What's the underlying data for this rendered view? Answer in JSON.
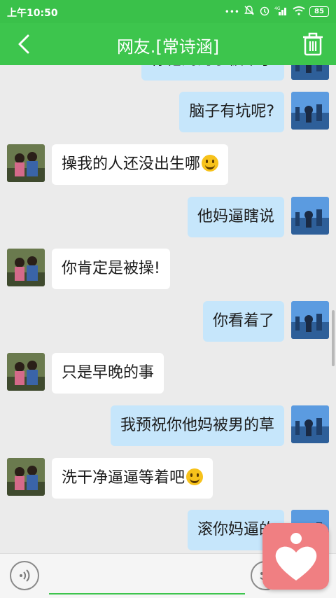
{
  "status_bar": {
    "time": "上午10:50",
    "battery": "85",
    "icons": [
      "more-dots-icon",
      "mute-bell-icon",
      "alarm-icon",
      "signal-4g-icon",
      "wifi-icon",
      "battery-icon"
    ]
  },
  "header": {
    "title": "网友.[常诗涵]",
    "back_icon": "chevron-left-icon",
    "trash_icon": "trash-icon"
  },
  "messages": [
    {
      "side": "right",
      "text": "你他妈的学被草了"
    },
    {
      "side": "right",
      "text": "脑子有坑呢?"
    },
    {
      "side": "left",
      "text": "操我的人还没出生哪",
      "emoji": true
    },
    {
      "side": "right",
      "text": "他妈逼瞎说"
    },
    {
      "side": "left",
      "text": "你肯定是被操!"
    },
    {
      "side": "right",
      "text": "你看着了"
    },
    {
      "side": "left",
      "text": "只是早晚的事"
    },
    {
      "side": "right",
      "text": "我预祝你他妈被男的草"
    },
    {
      "side": "left",
      "text": "洗干净逼逼等着吧",
      "emoji": true
    },
    {
      "side": "right",
      "text": "滚你妈逼的"
    }
  ],
  "input": {
    "placeholder": "",
    "voice_icon": "voice-icon",
    "emoji_icon": "smiley-icon"
  },
  "colors": {
    "header_green": "#3dc54d",
    "right_bubble": "#c6e6fb",
    "left_bubble": "#ffffff",
    "floating_app": "#f07f82"
  }
}
